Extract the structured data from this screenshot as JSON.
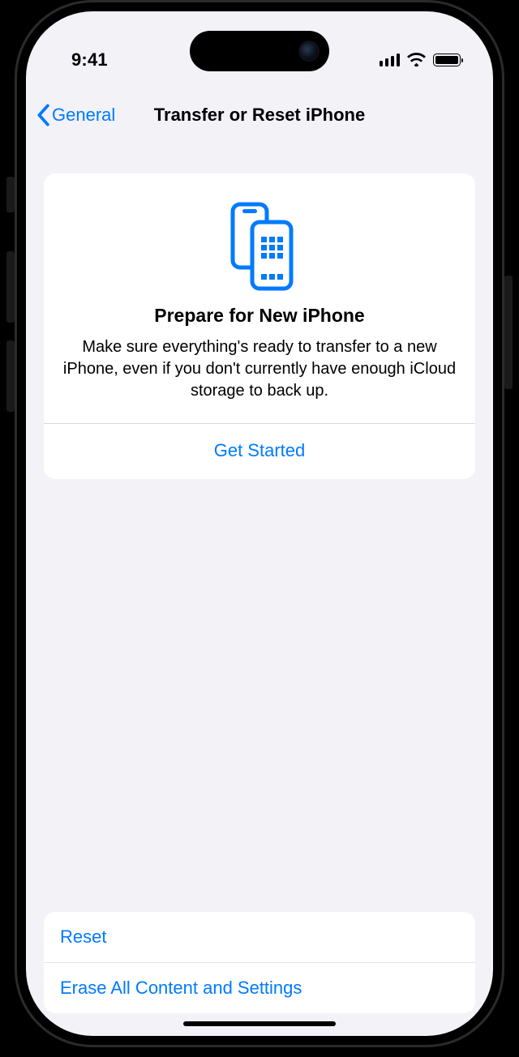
{
  "status": {
    "time": "9:41"
  },
  "nav": {
    "back_label": "General",
    "title": "Transfer or Reset iPhone"
  },
  "prepare_card": {
    "title": "Prepare for New iPhone",
    "body": "Make sure everything's ready to transfer to a new iPhone, even if you don't currently have enough iCloud storage to back up.",
    "cta": "Get Started"
  },
  "options": {
    "reset": "Reset",
    "erase": "Erase All Content and Settings"
  },
  "colors": {
    "tint": "#007aff",
    "background": "#f2f2f7",
    "card": "#ffffff"
  }
}
